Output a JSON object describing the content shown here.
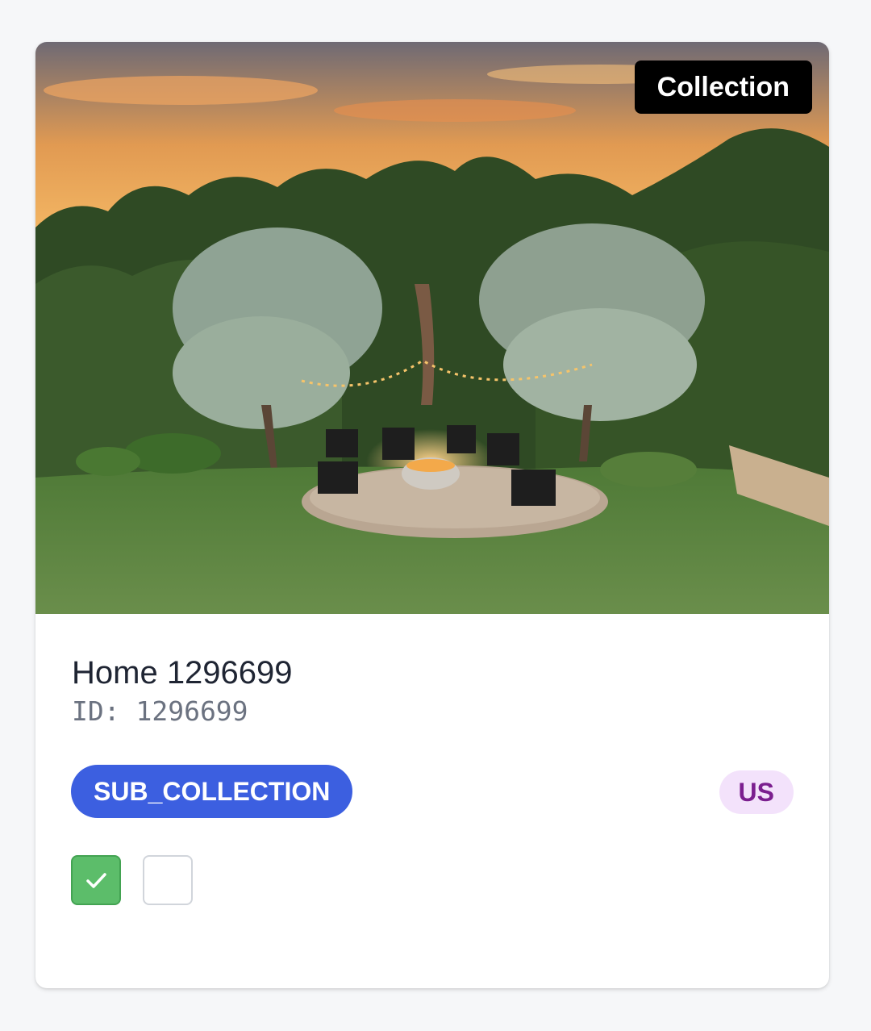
{
  "card": {
    "type_badge": "Collection",
    "title": "Home 1296699",
    "id_text": "ID: 1296699",
    "sub_type_badge": "SUB_COLLECTION",
    "country_badge": "US",
    "checkboxes": [
      {
        "checked": true
      },
      {
        "checked": false
      }
    ]
  },
  "colors": {
    "type_badge_bg": "#000000",
    "sub_type_badge_bg": "#3c5fe0",
    "country_badge_bg": "#f3e2fb",
    "country_badge_text": "#7b1f8f",
    "checkbox_checked": "#5cbd6a"
  },
  "icons": [
    "check-icon"
  ]
}
